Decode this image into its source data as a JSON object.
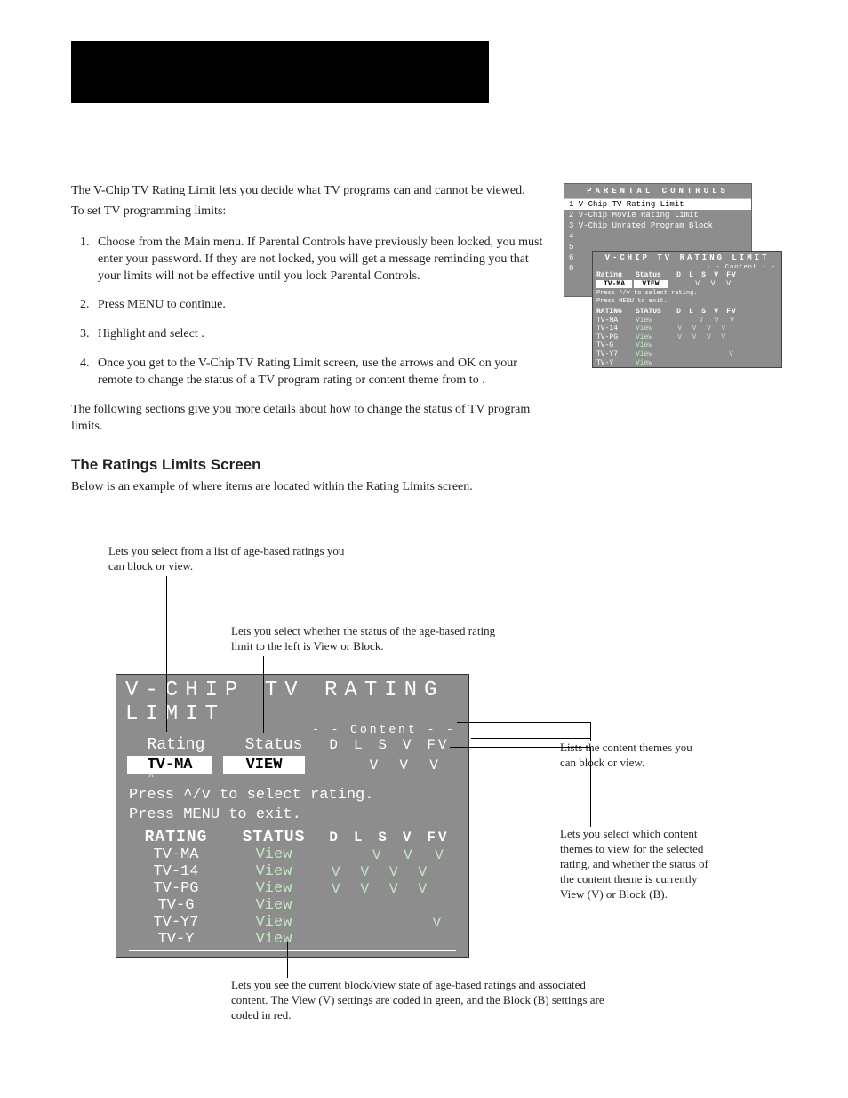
{
  "intro": {
    "p1": "The V-Chip TV Rating Limit lets you decide what TV programs can and cannot be viewed.",
    "p2": "To set TV programming limits:"
  },
  "steps": [
    "Choose                           from the Main menu. If Parental Controls have previously been locked, you must enter your password. If they are not locked, you will get a message reminding you that your limits will not be effective until you lock Parental Controls.",
    "Press MENU to continue.",
    "Highlight and select                                       .",
    "Once you get to the V-Chip TV Rating Limit screen, use the arrows and OK on your remote to change the status of a TV program rating or content theme from          to         ."
  ],
  "followup": "The following sections give you more details about how to change the status of TV program limits.",
  "ratings_heading": "The Ratings Limits Screen",
  "ratings_sub": "Below is an example of where items are located within the Rating Limits screen.",
  "thumb_back": {
    "title": "PARENTAL CONTROLS",
    "rows": [
      {
        "n": "1",
        "t": "V-Chip TV Rating Limit",
        "hi": true
      },
      {
        "n": "2",
        "t": "V-Chip Movie Rating Limit",
        "hi": false
      },
      {
        "n": "3",
        "t": "V-Chip Unrated Program Block",
        "hi": false
      },
      {
        "n": "4",
        "t": "",
        "hi": false
      },
      {
        "n": "5",
        "t": "",
        "hi": false
      },
      {
        "n": "6",
        "t": "",
        "hi": false
      },
      {
        "n": "0",
        "t": "",
        "hi": false
      }
    ]
  },
  "thumb_front": {
    "title": "V-CHIP TV RATING LIMIT",
    "content_tag": "- - Content - -",
    "hdr_rating": "Rating",
    "hdr_status": "Status",
    "hdr_cols": [
      "D",
      "L",
      "S",
      "V",
      "FV"
    ],
    "sel_rating": "TV-MA",
    "sel_status": "VIEW",
    "sel_cols": [
      "",
      "",
      "V",
      "V",
      "V"
    ],
    "hint1": "Press ^/v to select rating.",
    "hint2": "Press MENU to exit.",
    "hdr2_rating": "RATING",
    "hdr2_status": "STATUS"
  },
  "osd": {
    "title": "V-CHIP TV RATING LIMIT",
    "content_tag": "- -  Content  - -",
    "hdr_rating": "Rating",
    "hdr_status": "Status",
    "hdr_cols": [
      "D",
      "L",
      "S",
      "V",
      "FV"
    ],
    "sel_rating": "TV-MA",
    "sel_status": "VIEW",
    "sel_cols": [
      "",
      "",
      "V",
      "V",
      "V"
    ],
    "hint": "Press ^/v to select rating.\nPress MENU to exit.",
    "hdr2_rating": "RATING",
    "hdr2_status": "STATUS",
    "hdr2_cols": [
      "D",
      "L",
      "S",
      "V",
      "FV"
    ],
    "rows": [
      {
        "rating": "TV-MA",
        "status": "View",
        "cols": [
          "",
          "",
          "V",
          "V",
          "V"
        ]
      },
      {
        "rating": "TV-14",
        "status": "View",
        "cols": [
          "V",
          "V",
          "V",
          "V",
          ""
        ]
      },
      {
        "rating": "TV-PG",
        "status": "View",
        "cols": [
          "V",
          "V",
          "V",
          "V",
          ""
        ]
      },
      {
        "rating": "TV-G",
        "status": "View",
        "cols": [
          "",
          "",
          "",
          "",
          ""
        ]
      },
      {
        "rating": "TV-Y7",
        "status": "View",
        "cols": [
          "",
          "",
          "",
          "",
          "V"
        ]
      },
      {
        "rating": "TV-Y",
        "status": "View",
        "cols": [
          "",
          "",
          "",
          "",
          ""
        ]
      }
    ]
  },
  "callouts": {
    "c1": "Lets you select from a list of age-based ratings you can block or view.",
    "c2": "Lets you select whether the status of the age-based rating limit to the left is View or Block.",
    "c3": "Lists the content themes you can block or view.",
    "c4": "Lets you select which content themes to view for the selected rating, and whether the status of the content theme is currently View (V) or Block (B).",
    "c5": "Lets you see the current block/view state of age-based ratings and associated content. The View (V) settings are coded in green, and the Block (B) settings are coded in red."
  }
}
